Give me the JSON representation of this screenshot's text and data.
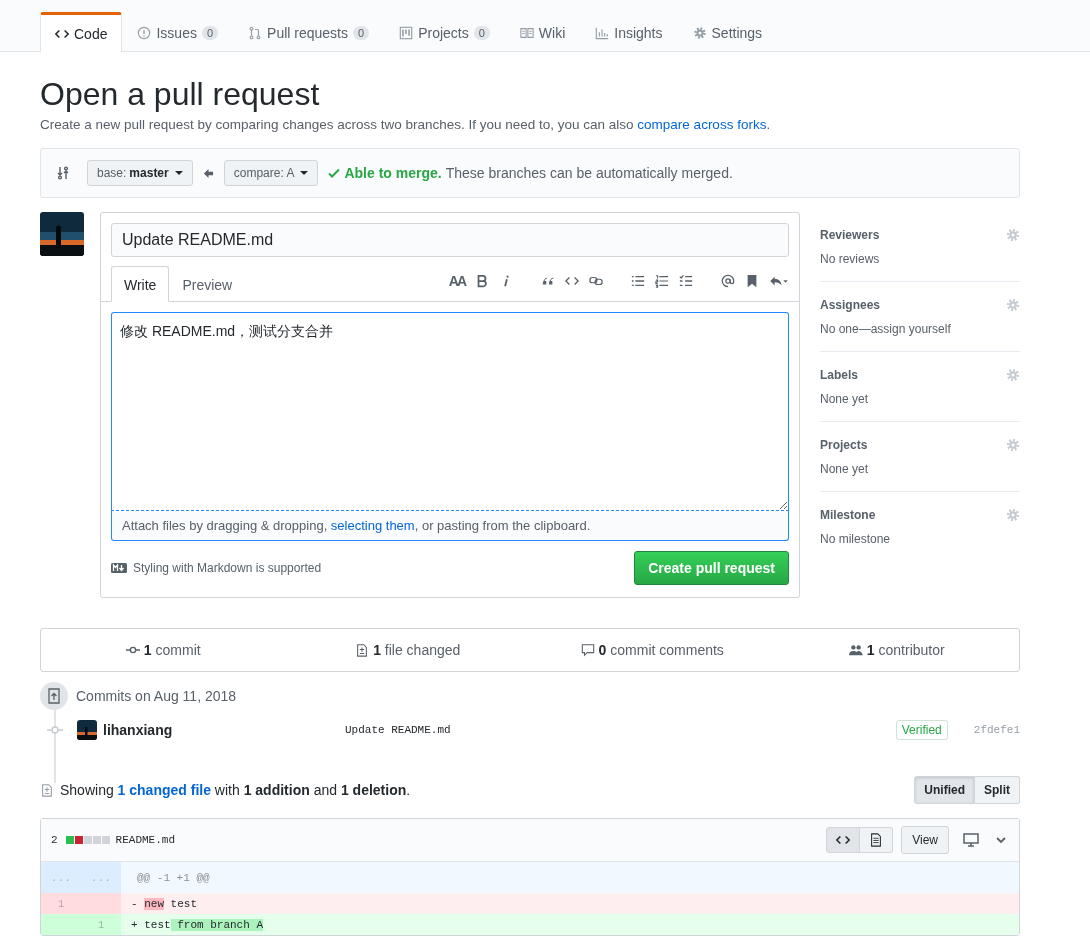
{
  "tabs": [
    {
      "label": "Code",
      "selected": true
    },
    {
      "label": "Issues",
      "count": "0",
      "selected": false
    },
    {
      "label": "Pull requests",
      "count": "0",
      "selected": false
    },
    {
      "label": "Projects",
      "count": "0",
      "selected": false
    },
    {
      "label": "Wiki",
      "selected": false
    },
    {
      "label": "Insights",
      "selected": false
    },
    {
      "label": "Settings",
      "selected": false
    }
  ],
  "title": "Open a pull request",
  "subtitle": "Create a new pull request by comparing changes across two branches. If you need to, you can also ",
  "subtitle_link": "compare across forks",
  "subtitle_end": ".",
  "compare_bar": {
    "base_label": "base:",
    "base": "master",
    "compare_label": "compare:",
    "compare": "A",
    "status": "Able to merge.",
    "status_note": "These branches can be automatically merged."
  },
  "form": {
    "title_value": "Update README.md",
    "tabs": [
      {
        "label": "Write",
        "selected": true
      },
      {
        "label": "Preview",
        "selected": false
      }
    ],
    "text_size_tool": "AA",
    "body_value": "修改 README.md，测试分支合并",
    "attach_before": "Attach files by dragging & dropping, ",
    "attach_link": "selecting them",
    "attach_after": ", or pasting from the clipboard.",
    "markdown_note": "Styling with Markdown is supported",
    "submit": "Create pull request"
  },
  "sidebar": [
    {
      "heading": "Reviewers",
      "value": "No reviews"
    },
    {
      "heading": "Assignees",
      "value": "No one—assign yourself"
    },
    {
      "heading": "Labels",
      "value": "None yet"
    },
    {
      "heading": "Projects",
      "value": "None yet"
    },
    {
      "heading": "Milestone",
      "value": "No milestone"
    }
  ],
  "stats": [
    "**1** commit",
    "**1** file changed",
    "**0** commit comments",
    "**1** contributor"
  ],
  "commits": {
    "date": "Commits on Aug 11, 2018",
    "items": [
      {
        "author": "lihanxiang",
        "message": "Update README.md",
        "badge": "Verified",
        "sha": "2fdefe1"
      }
    ]
  },
  "changes": {
    "summary": "Showing **1 changed file** with **1 addition** and **1 deletion**.",
    "views": [
      {
        "label": "Unified",
        "selected": true
      },
      {
        "label": "Split",
        "selected": false
      }
    ]
  },
  "file": {
    "count": "2",
    "diffstat": [
      {
        "color": "#2cbe4e"
      },
      {
        "color": "#cb2431"
      },
      {
        "color": "#d1d5da"
      },
      {
        "color": "#d1d5da"
      },
      {
        "color": "#d1d5da"
      }
    ],
    "name": "README.md",
    "view": "View",
    "lines": [
      {
        "kind": "hunk",
        "old": "...",
        "new": "...",
        "text": "@@ -1 +1 @@"
      },
      {
        "kind": "del",
        "old": "1",
        "segments": [
          {
            "text": "- ",
            "hl": false
          },
          {
            "text": "new",
            "hl": true
          },
          {
            "text": " test",
            "hl": false
          }
        ]
      },
      {
        "kind": "add",
        "new": "1",
        "segments": [
          {
            "text": "+ test",
            "hl": false
          },
          {
            "text": " from branch A",
            "hl": true
          }
        ]
      }
    ]
  }
}
